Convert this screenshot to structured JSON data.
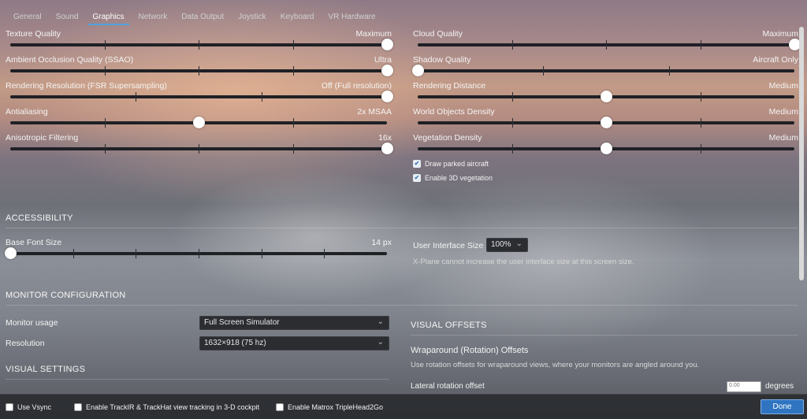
{
  "tabs": [
    {
      "label": "General"
    },
    {
      "label": "Sound"
    },
    {
      "label": "Graphics",
      "active": true
    },
    {
      "label": "Network"
    },
    {
      "label": "Data Output"
    },
    {
      "label": "Joystick"
    },
    {
      "label": "Keyboard"
    },
    {
      "label": "VR Hardware"
    }
  ],
  "graphics_left": [
    {
      "label": "Texture Quality",
      "value": "Maximum",
      "level": 1.0
    },
    {
      "label": "Ambient Occlusion Quality (SSAO)",
      "value": "Ultra",
      "level": 1.0
    },
    {
      "label": "Rendering Resolution (FSR Supersampling)",
      "value": "Off (Full resolution)",
      "level": 1.0
    },
    {
      "label": "Antialiasing",
      "value": "2x MSAA",
      "level": 0.5
    },
    {
      "label": "Anisotropic Filtering",
      "value": "16x",
      "level": 1.0
    }
  ],
  "graphics_right": [
    {
      "label": "Cloud Quality",
      "value": "Maximum",
      "level": 1.0
    },
    {
      "label": "Shadow Quality",
      "value": "Aircraft Only",
      "level": 0.0
    },
    {
      "label": "Rendering Distance",
      "value": "Medium",
      "level": 0.5
    },
    {
      "label": "World Objects Density",
      "value": "Medium",
      "level": 0.5
    },
    {
      "label": "Vegetation Density",
      "value": "Medium",
      "level": 0.5
    }
  ],
  "graphics_checks": [
    {
      "label": "Draw parked aircraft",
      "checked": true
    },
    {
      "label": "Enable 3D vegetation",
      "checked": true
    }
  ],
  "accessibility": {
    "title": "ACCESSIBILITY",
    "font_size_label": "Base Font Size",
    "font_size_value": "14 px",
    "font_size_level": 0.0,
    "ui_size_label": "User Interface Size",
    "ui_size_value": "100%",
    "ui_size_note": "X-Plane cannot increase the user interface size at this screen size."
  },
  "monitor": {
    "title": "MONITOR CONFIGURATION",
    "usage_label": "Monitor usage",
    "usage_value": "Full Screen Simulator",
    "resolution_label": "Resolution",
    "resolution_value": "1632×918 (75 hz)"
  },
  "visual_settings": {
    "title": "VISUAL SETTINGS"
  },
  "visual_offsets": {
    "title": "VISUAL OFFSETS",
    "subtitle": "Wraparound (Rotation) Offsets",
    "description": "Use rotation offsets for wraparound views, where your monitors are angled around you.",
    "lateral_label": "Lateral rotation offset",
    "lateral_value": "0.00",
    "lateral_unit": "degrees"
  },
  "bottom": {
    "checks": [
      {
        "label": "Use Vsync",
        "checked": false
      },
      {
        "label": "Enable TrackIR & TrackHat view tracking in 3-D cockpit",
        "checked": false
      },
      {
        "label": "Enable Matrox TripleHead2Go",
        "checked": false
      }
    ],
    "done_label": "Done"
  },
  "colors": {
    "accent": "#4ea3e0",
    "done_button": "#2f74c0"
  }
}
